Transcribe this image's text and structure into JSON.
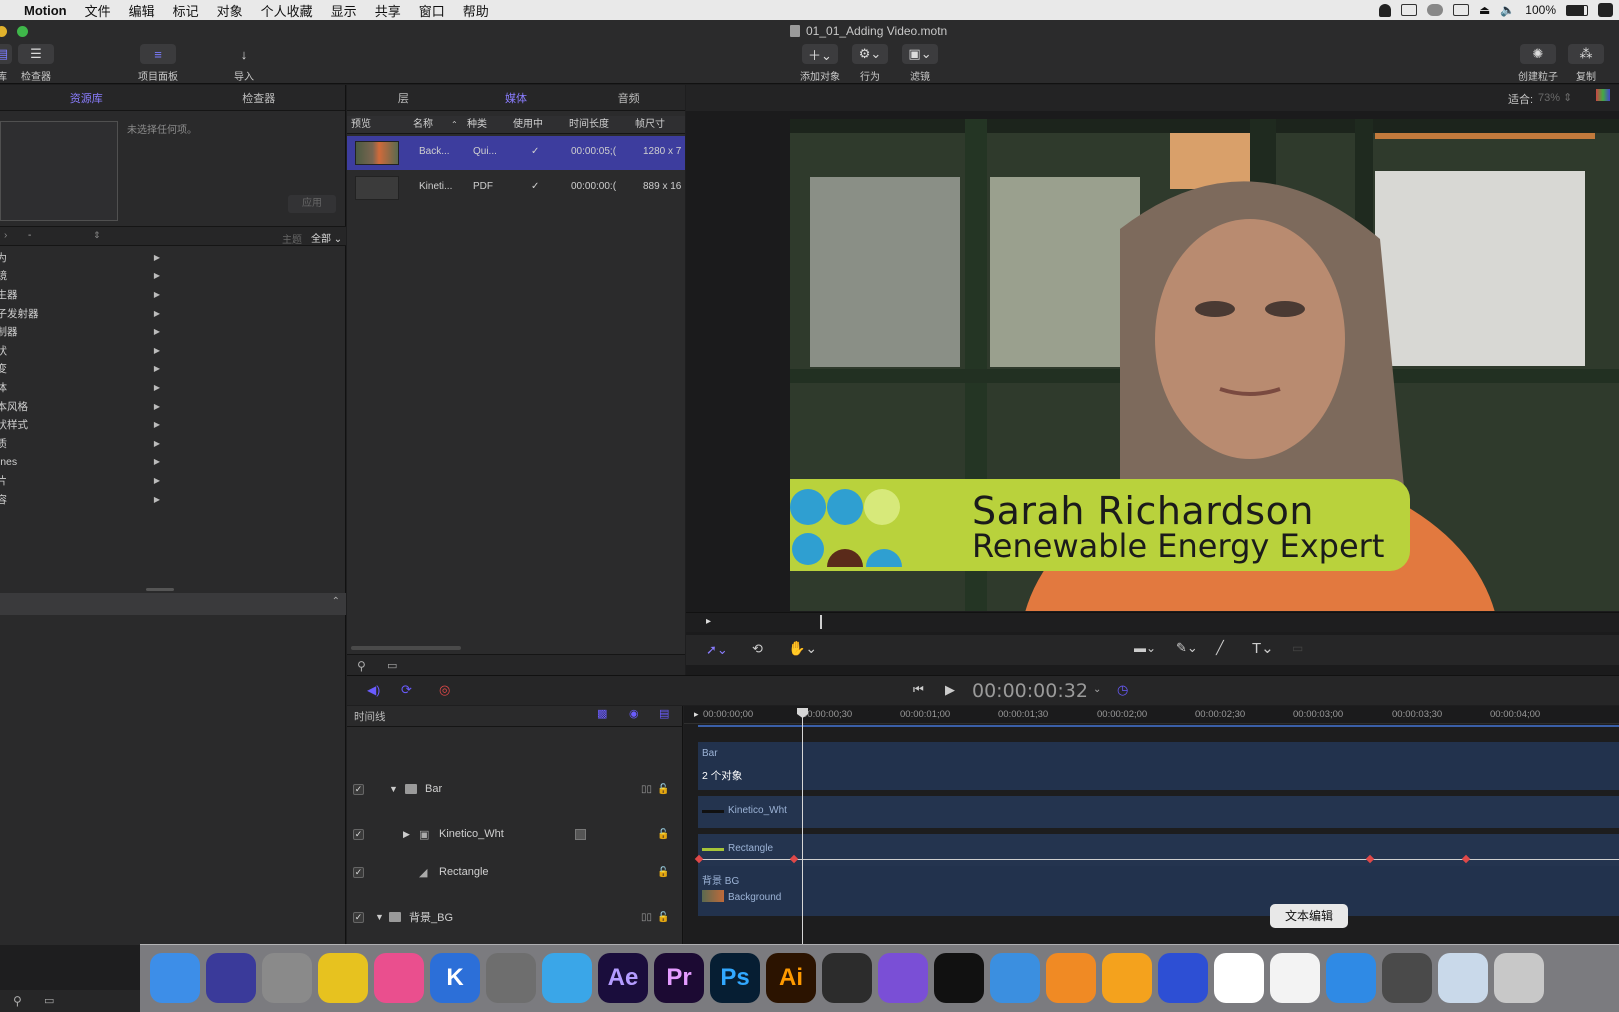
{
  "menubar": {
    "app_name": "Motion",
    "items": [
      "文件",
      "编辑",
      "标记",
      "对象",
      "个人收藏",
      "显示",
      "共享",
      "窗口",
      "帮助"
    ],
    "battery": "100%"
  },
  "window": {
    "title": "01_01_Adding Video.motn"
  },
  "toolbar": {
    "left": [
      {
        "label": "检查器",
        "icon": "sliders-icon"
      },
      {
        "label": "项目面板",
        "icon": "list-icon"
      },
      {
        "label": "导入",
        "icon": "import-arrow-icon"
      }
    ],
    "left_partial": "库",
    "center": [
      {
        "label": "添加对象",
        "icon": "plus-icon"
      },
      {
        "label": "行为",
        "icon": "gear-icon"
      },
      {
        "label": "滤镜",
        "icon": "filter-icon"
      }
    ],
    "right": [
      {
        "label": "创建粒子",
        "icon": "particle-icon"
      },
      {
        "label": "复制",
        "icon": "replicate-icon"
      }
    ]
  },
  "library": {
    "tabs": [
      "资源库",
      "检查器"
    ],
    "active_tab": "资源库",
    "no_selection": "未选择任何项。",
    "apply_button": "应用",
    "filter_dash": "-",
    "theme_label": "主题",
    "theme_value": "全部",
    "categories": [
      "行为",
      "滤镜",
      "发生器",
      "粒子发射器",
      "复制器",
      "形状",
      "渐变",
      "字体",
      "文本风格",
      "形状样式",
      "材质",
      "iTunes",
      "照片",
      "内容"
    ]
  },
  "project_panel": {
    "tabs": [
      "层",
      "媒体",
      "音频"
    ],
    "active_tab": "媒体",
    "columns": [
      "预览",
      "名称",
      "种类",
      "使用中",
      "时间长度",
      "帧尺寸"
    ],
    "rows": [
      {
        "name": "Back...",
        "kind": "Qui...",
        "in_use": "✓",
        "duration": "00:00:05;(",
        "size": "1280 x 7"
      },
      {
        "name": "Kineti...",
        "kind": "PDF",
        "in_use": "✓",
        "duration": "00:00:00:(",
        "size": "889 x 16"
      }
    ]
  },
  "canvas": {
    "fit_label": "适合:",
    "zoom": "73%",
    "lower_third_name": "Sarah Richardson",
    "lower_third_title": "Renewable Energy Expert"
  },
  "transport": {
    "timecode": "00:00:00:32"
  },
  "timeline": {
    "title": "时间线",
    "ruler": [
      "00:00:00;00",
      "00:00:00;30",
      "00:00:01;00",
      "00:00:01;30",
      "00:00:02;00",
      "00:00:02;30",
      "00:00:03;00",
      "00:00:03;30",
      "00:00:04;00"
    ],
    "layers": [
      {
        "name": "Bar",
        "type": "group",
        "expanded": true
      },
      {
        "name": "Kinetico_Wht",
        "type": "image",
        "indent": 1
      },
      {
        "name": "Rectangle",
        "type": "shape",
        "indent": 1
      },
      {
        "name": "背景_BG",
        "type": "group",
        "expanded": true
      }
    ],
    "tracks": {
      "bar_label": "Bar",
      "bar_count": "2 个对象",
      "kinetico": "Kinetico_Wht",
      "rectangle": "Rectangle",
      "bg_label": "背景 BG",
      "background": "Background"
    }
  },
  "dock": {
    "tooltip": "文本编辑",
    "apps": [
      {
        "label": "",
        "name": "finder-icon",
        "color": "#3d8ee8"
      },
      {
        "label": "",
        "name": "siri-icon",
        "color": "#3a3a9a"
      },
      {
        "label": "",
        "name": "launchpad-icon",
        "color": "#8a8a8a"
      },
      {
        "label": "",
        "name": "chrome-icon",
        "color": "#e7c21f"
      },
      {
        "label": "",
        "name": "itunes-icon",
        "color": "#ea4f8e"
      },
      {
        "label": "K",
        "name": "kuwo-icon",
        "color": "#2c6fd8"
      },
      {
        "label": "",
        "name": "system-preferences-icon",
        "color": "#6e6e6e"
      },
      {
        "label": "",
        "name": "bird-app-icon",
        "color": "#3aa6e8"
      },
      {
        "label": "Ae",
        "name": "after-effects-icon",
        "color": "#1a0d3c"
      },
      {
        "label": "Pr",
        "name": "premiere-icon",
        "color": "#1c0a33"
      },
      {
        "label": "Ps",
        "name": "photoshop-icon",
        "color": "#061e33"
      },
      {
        "label": "Ai",
        "name": "illustrator-icon",
        "color": "#2b1300"
      },
      {
        "label": "",
        "name": "final-cut-icon",
        "color": "#2c2c2c"
      },
      {
        "label": "",
        "name": "motion-icon",
        "color": "#7a4fd6"
      },
      {
        "label": "",
        "name": "qq-icon",
        "color": "#111111"
      },
      {
        "label": "",
        "name": "fish-app-icon",
        "color": "#3b8fe0"
      },
      {
        "label": "",
        "name": "fox-app-icon",
        "color": "#f08a24"
      },
      {
        "label": "",
        "name": "player-app-icon",
        "color": "#f4a21d"
      },
      {
        "label": "",
        "name": "video-app-icon",
        "color": "#2d4fd4"
      },
      {
        "label": "",
        "name": "baidu-cloud-icon",
        "color": "#ffffff"
      },
      {
        "label": "",
        "name": "textedit-icon",
        "color": "#f3f3f3"
      },
      {
        "label": "",
        "name": "safari-icon",
        "color": "#2f8ae5"
      },
      {
        "label": "",
        "name": "presentation-icon",
        "color": "#4a4a4a"
      },
      {
        "label": "",
        "name": "folder-icon",
        "color": "#c9d9ea"
      },
      {
        "label": "",
        "name": "trash-icon",
        "color": "#c8c8c8"
      }
    ]
  }
}
